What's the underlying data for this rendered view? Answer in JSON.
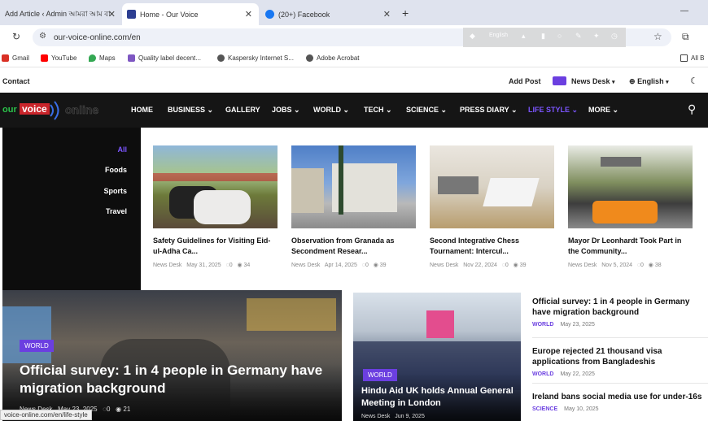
{
  "tabs": [
    {
      "title": "Add Article ‹ Admin আমরা আম বা",
      "active": false
    },
    {
      "title": "Home - Our Voice",
      "active": true
    },
    {
      "title": "(20+) Facebook",
      "active": false
    }
  ],
  "browser": {
    "url": "our-voice-online.com/en",
    "new_tab": "+",
    "minimize": "—",
    "ext_text": "English"
  },
  "bookmarks": [
    {
      "label": "Gmail",
      "color": "#d93025"
    },
    {
      "label": "YouTube",
      "color": "#ff0000"
    },
    {
      "label": "Maps",
      "color": "#34a853"
    },
    {
      "label": "Quality label decent...",
      "color": "#7e57c2"
    },
    {
      "label": "Kaspersky Internet S...",
      "color": "#555555"
    },
    {
      "label": "Adobe Acrobat",
      "color": "#555555"
    }
  ],
  "bookmark_folder": "All B",
  "util": {
    "contact": "Contact",
    "add_post": "Add Post",
    "news_desk": "News Desk",
    "language": "English"
  },
  "logo": {
    "part1": "our",
    "part2": "voice",
    "part3": "online"
  },
  "nav": [
    {
      "label": "HOME"
    },
    {
      "label": "BUSINESS"
    },
    {
      "label": "GALLERY"
    },
    {
      "label": "JOBS"
    },
    {
      "label": "WORLD"
    },
    {
      "label": "TECH"
    },
    {
      "label": "SCIENCE"
    },
    {
      "label": "PRESS DIARY"
    },
    {
      "label": "LIFE STYLE",
      "active": true
    },
    {
      "label": "MORE"
    }
  ],
  "mega_categories": [
    "All",
    "Foods",
    "Sports",
    "Travel"
  ],
  "mega_cards": [
    {
      "title": "Safety Guidelines for Visiting Eid-ul-Adha Ca...",
      "author": "News Desk",
      "date": "May 31, 2025",
      "comments": "0",
      "views": "34"
    },
    {
      "title": "Observation from Granada as Secondment Resear...",
      "author": "News Desk",
      "date": "Apr 14, 2025",
      "comments": "0",
      "views": "39"
    },
    {
      "title": "Second Integrative Chess Tournament: Intercul...",
      "author": "News Desk",
      "date": "Nov 22, 2024",
      "comments": "0",
      "views": "39"
    },
    {
      "title": "Mayor Dr Leonhardt Took Part in the Community...",
      "author": "News Desk",
      "date": "Nov 5, 2024",
      "comments": "0",
      "views": "38"
    }
  ],
  "hero": {
    "badge": "WORLD",
    "title": "Official survey: 1 in 4 people in Germany have migration background",
    "author": "News Desk",
    "date": "May 23, 2025",
    "comments": "0",
    "views": "21"
  },
  "mid": {
    "badge": "WORLD",
    "title": "Hindu Aid UK holds Annual General Meeting in London",
    "author": "News Desk",
    "date": "Jun 9, 2025"
  },
  "side_list": [
    {
      "title": "Official survey: 1 in 4 people in Germany have migration background",
      "category": "WORLD",
      "date": "May 23, 2025"
    },
    {
      "title": "Europe rejected 21 thousand visa applications from Bangladeshis",
      "category": "WORLD",
      "date": "May 22, 2025"
    },
    {
      "title": "Ireland bans social media use for under-16s",
      "category": "SCIENCE",
      "date": "May 10, 2025"
    }
  ],
  "status_url": "voice-online.com/en/life-style",
  "colors": {
    "accent": "#6b3fe0",
    "nav_bg": "#151515",
    "tabbar": "#dfe3ee"
  }
}
